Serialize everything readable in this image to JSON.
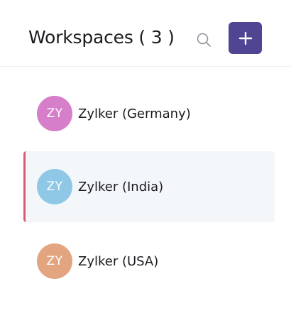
{
  "header": {
    "title": "Workspaces",
    "count": "( 3 )",
    "search_icon": "search-icon",
    "add_icon": "plus-icon"
  },
  "colors": {
    "accent": "#4f4593",
    "selected_bar": "#d95a70",
    "selected_bg": "#f4f7fa"
  },
  "workspaces": [
    {
      "initials": "ZY",
      "name": "Zylker (Germany)",
      "avatar_color": "#d77ecb",
      "selected": false
    },
    {
      "initials": "ZY",
      "name": "Zylker (India)",
      "avatar_color": "#8ec8e6",
      "selected": true
    },
    {
      "initials": "ZY",
      "name": "Zylker (USA)",
      "avatar_color": "#e2a57f",
      "selected": false
    }
  ]
}
